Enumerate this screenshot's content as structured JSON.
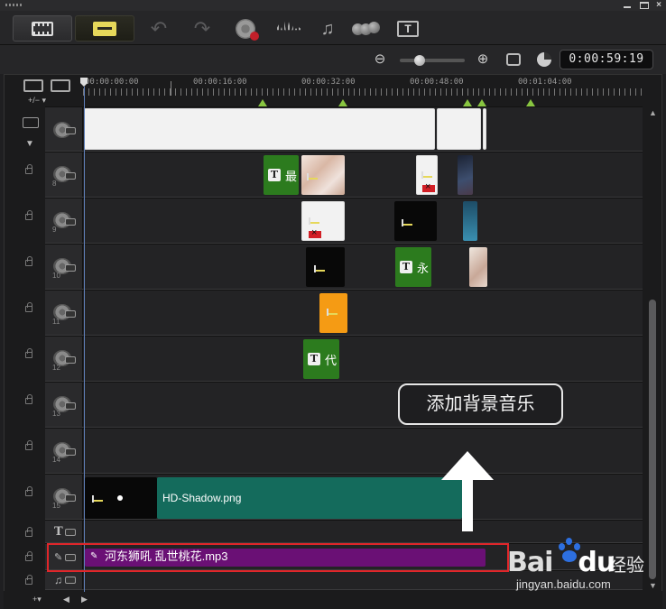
{
  "toolbar": {
    "buttons": [
      "timeline-view",
      "storyboard-view",
      "undo",
      "redo",
      "record-capture",
      "audio-mixer",
      "auto-music",
      "motion-tracking",
      "subtitle-editor"
    ]
  },
  "zoom": {
    "timecode": "0:00:59:19",
    "level": 0.3
  },
  "ruler": {
    "labels": [
      "00:00:00:00",
      "00:00:16:00",
      "00:00:32:00",
      "00:00:48:00",
      "00:01:04:00"
    ]
  },
  "tracks": {
    "nums": [
      "8",
      "9",
      "10",
      "11",
      "12",
      "13",
      "14",
      "15"
    ],
    "clips": {
      "title_a": "最",
      "title_b": "永",
      "title_c": "代",
      "overlay_15": "HD-Shadow.png",
      "music": "河东狮吼 乱世桃花.mp3"
    }
  },
  "annotation": {
    "callout": "添加背景音乐"
  },
  "watermark": {
    "brand_a": "Bai",
    "brand_b": "du",
    "cn": "经验",
    "url": "jingyan.baidu.com"
  }
}
